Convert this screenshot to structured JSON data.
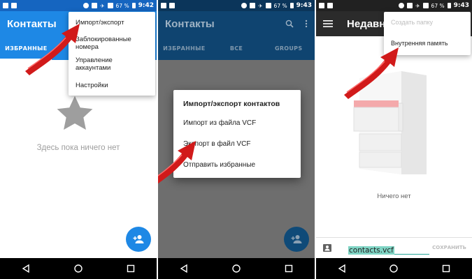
{
  "colors": {
    "primary": "#1e88e5",
    "primary_dark": "#1565c0",
    "dimmed_primary": "#0f4470",
    "dim_overlay": "#6e6e6e",
    "fab": "#1e88e5",
    "fab_dim": "#0f4a78",
    "arrow": "#d11a1a",
    "file_highlight": "#7fd4c4"
  },
  "panel1": {
    "status": {
      "battery": "67 %",
      "time": "9:42"
    },
    "appbar": {
      "title": "Контакты"
    },
    "tabs": [
      "ИЗБРАННЫЕ",
      "",
      ""
    ],
    "menu": [
      "Импорт/экспорт",
      "Заблокированные номера",
      "Управление аккаунтами",
      "Настройки"
    ],
    "empty_text": "Здесь пока ничего нет"
  },
  "panel2": {
    "status": {
      "battery": "67 %",
      "time": "9:43"
    },
    "appbar": {
      "title": "Контакты"
    },
    "tabs": [
      "ИЗБРАННЫЕ",
      "ВСЕ",
      "GROUPS"
    ],
    "dialog": {
      "title": "Импорт/экспорт контактов",
      "items": [
        "Импорт из файла VCF",
        "Экспорт в файл VCF",
        "Отправить избранные"
      ]
    }
  },
  "panel3": {
    "status": {
      "battery": "67 %",
      "time": "9:43"
    },
    "appbar": {
      "title": "Недавние"
    },
    "menu": [
      "Создать папку",
      "Внутренняя память"
    ],
    "empty_text": "Ничего нет",
    "filename": "contacts.vcf",
    "save_label": "СОХРАНИТЬ"
  }
}
